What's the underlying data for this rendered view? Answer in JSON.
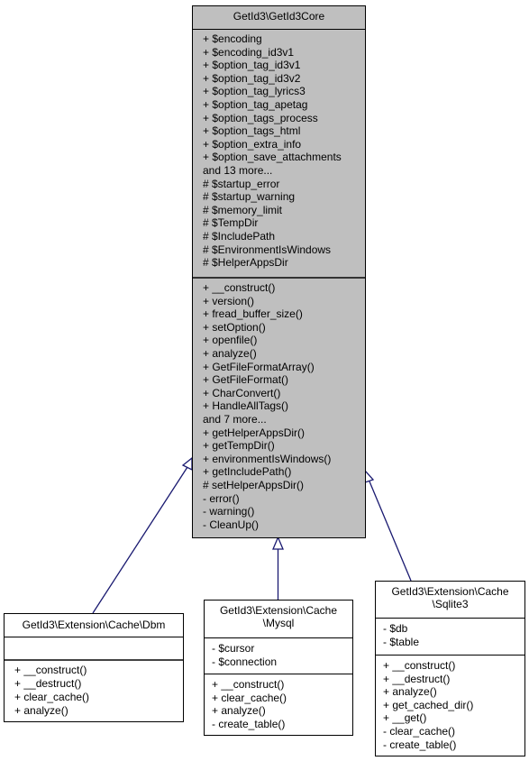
{
  "diagram": {
    "type": "uml-class-inheritance",
    "edge_color": "#191970",
    "classes": {
      "core": {
        "name": "GetId3\\GetId3Core",
        "attributes": [
          "+ $encoding",
          "+ $encoding_id3v1",
          "+ $option_tag_id3v1",
          "+ $option_tag_id3v2",
          "+ $option_tag_lyrics3",
          "+ $option_tag_apetag",
          "+ $option_tags_process",
          "+ $option_tags_html",
          "+ $option_extra_info",
          "+ $option_save_attachments",
          "and 13 more...",
          "# $startup_error",
          "# $startup_warning",
          "# $memory_limit",
          "# $TempDir",
          "# $IncludePath",
          "# $EnvironmentIsWindows",
          "# $HelperAppsDir"
        ],
        "methods": [
          "+ __construct()",
          "+ version()",
          "+ fread_buffer_size()",
          "+ setOption()",
          "+ openfile()",
          "+ analyze()",
          "+ GetFileFormatArray()",
          "+ GetFileFormat()",
          "+ CharConvert()",
          "+ HandleAllTags()",
          "and 7 more...",
          "+ getHelperAppsDir()",
          "+ getTempDir()",
          "+ environmentIsWindows()",
          "+ getIncludePath()",
          "# setHelperAppsDir()",
          "- error()",
          "- warning()",
          "- CleanUp()"
        ]
      },
      "dbm": {
        "name": "GetId3\\Extension\\Cache\\Dbm",
        "attributes": [],
        "methods": [
          "+ __construct()",
          "+ __destruct()",
          "+ clear_cache()",
          "+ analyze()"
        ]
      },
      "mysql": {
        "name_lines": [
          "GetId3\\Extension\\Cache",
          "\\Mysql"
        ],
        "attributes": [
          "- $cursor",
          "- $connection"
        ],
        "methods": [
          "+ __construct()",
          "+ clear_cache()",
          "+ analyze()",
          "- create_table()"
        ]
      },
      "sqlite3": {
        "name_lines": [
          "GetId3\\Extension\\Cache",
          "\\Sqlite3"
        ],
        "attributes": [
          "- $db",
          "- $table"
        ],
        "methods": [
          "+ __construct()",
          "+ __destruct()",
          "+ analyze()",
          "+ get_cached_dir()",
          "+ __get()",
          "- clear_cache()",
          "- create_table()"
        ]
      }
    },
    "edges": [
      {
        "from": "dbm",
        "to": "core",
        "kind": "inherits"
      },
      {
        "from": "mysql",
        "to": "core",
        "kind": "inherits"
      },
      {
        "from": "sqlite3",
        "to": "core",
        "kind": "inherits"
      }
    ]
  }
}
